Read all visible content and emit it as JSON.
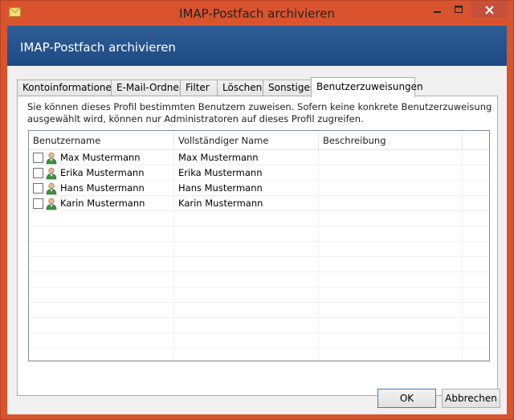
{
  "window": {
    "title": "IMAP-Postfach archivieren"
  },
  "header": {
    "title": "IMAP-Postfach archivieren"
  },
  "tabs": [
    {
      "label": "Kontoinformationen"
    },
    {
      "label": "E-Mail-Ordner"
    },
    {
      "label": "Filter"
    },
    {
      "label": "Löschen"
    },
    {
      "label": "Sonstiges"
    },
    {
      "label": "Benutzerzuweisungen"
    }
  ],
  "panel": {
    "description": "Sie können dieses Profil bestimmten Benutzern zuweisen. Sofern keine konkrete Benutzerzuweisung ausgewählt wird, können nur Administratoren auf dieses Profil zugreifen."
  },
  "grid": {
    "columns": [
      "Benutzername",
      "Vollständiger Name",
      "Beschreibung"
    ],
    "rows": [
      {
        "username": "Max Mustermann",
        "fullname": "Max Mustermann",
        "description": ""
      },
      {
        "username": "Erika Mustermann",
        "fullname": "Erika Mustermann",
        "description": ""
      },
      {
        "username": "Hans Mustermann",
        "fullname": "Hans Mustermann",
        "description": ""
      },
      {
        "username": "Karin Mustermann",
        "fullname": "Karin Mustermann",
        "description": ""
      }
    ]
  },
  "buttons": {
    "ok": "OK",
    "cancel": "Abbrechen"
  },
  "icons": {
    "app": "envelope-icon",
    "user": "user-icon"
  }
}
